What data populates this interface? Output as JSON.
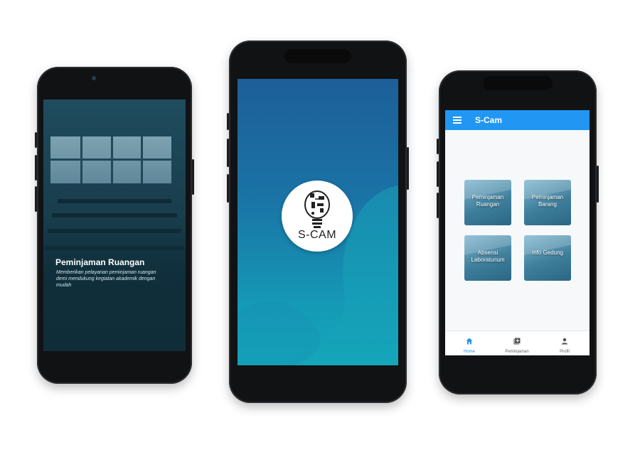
{
  "phone1": {
    "title": "Peminjaman Ruangan",
    "description": "Memberikan pelayanan peminjaman ruangan demi mendukung kegiatan akademik dengan mudah"
  },
  "phone2": {
    "logo_text": "S-CAM"
  },
  "phone3": {
    "app_title": "S-Cam",
    "menu_icon": "hamburger-menu-icon",
    "tiles": [
      {
        "label": "Peminjaman Ruangan"
      },
      {
        "label": "Peminjaman Barang"
      },
      {
        "label": "Absensi Laboraturium"
      },
      {
        "label": "Info Gedung"
      }
    ],
    "nav": [
      {
        "label": "Home",
        "icon": "home-icon",
        "active": true
      },
      {
        "label": "Peminjaman",
        "icon": "add-box-icon",
        "active": false
      },
      {
        "label": "Profil",
        "icon": "person-icon",
        "active": false
      }
    ],
    "accent": "#2196f3"
  }
}
